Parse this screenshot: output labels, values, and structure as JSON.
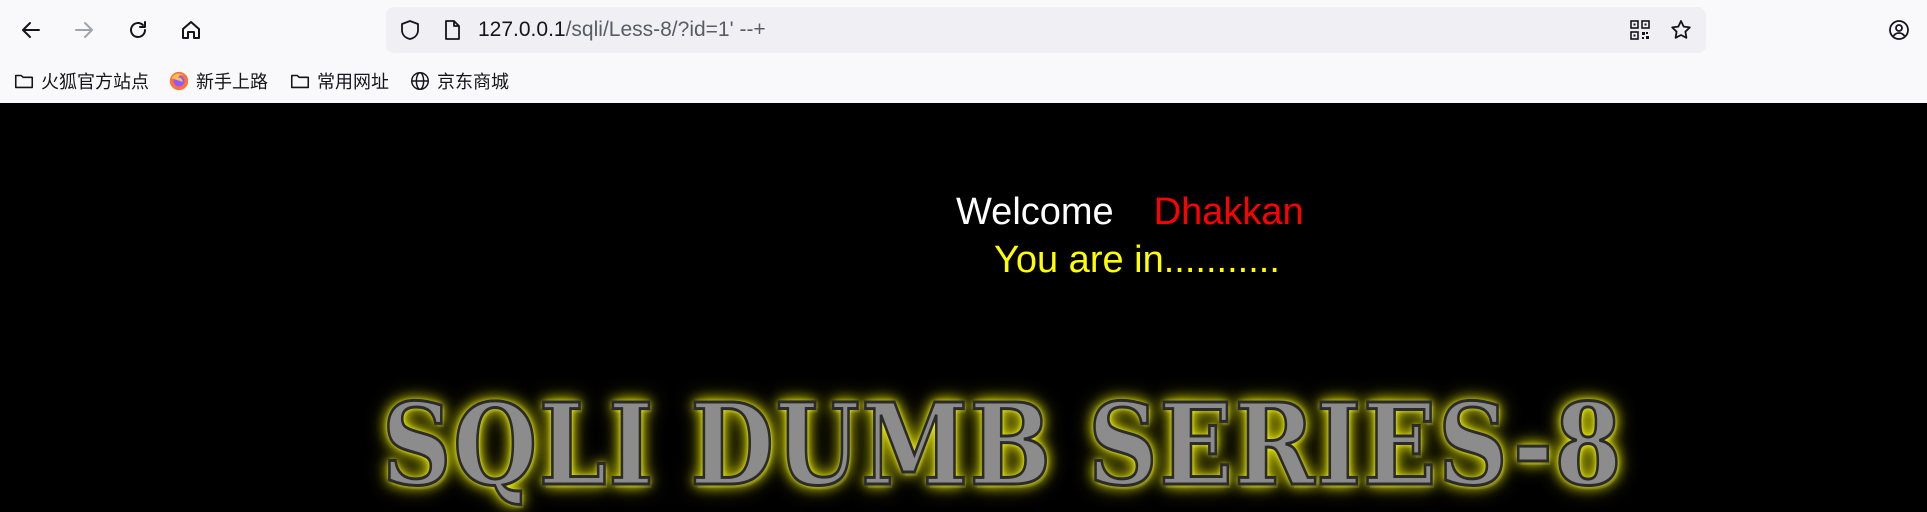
{
  "browser": {
    "url": {
      "host": "127.0.0.1",
      "path": "/sqli/Less-8/?id=1' --+"
    },
    "icons": {
      "back": "back-arrow-icon",
      "forward": "forward-arrow-icon",
      "reload": "reload-icon",
      "home": "home-icon",
      "shield": "shield-icon",
      "page": "page-icon",
      "qr": "qr-code-icon",
      "star": "bookmark-star-icon",
      "account": "account-icon"
    },
    "bookmarks": [
      {
        "label": "火狐官方站点",
        "icon": "folder-icon"
      },
      {
        "label": "新手上路",
        "icon": "firefox-icon"
      },
      {
        "label": "常用网址",
        "icon": "folder-icon"
      },
      {
        "label": "京东商城",
        "icon": "globe-icon"
      }
    ]
  },
  "page": {
    "welcome": "Welcome",
    "user": "Dhakkan",
    "status": "You are in...........",
    "banner": "SQLI DUMB SERIES-8",
    "colors": {
      "background": "#000000",
      "welcome": "#ffffff",
      "user": "#ff0000",
      "status": "#ffff00",
      "banner_glow": "#ffff00"
    }
  }
}
